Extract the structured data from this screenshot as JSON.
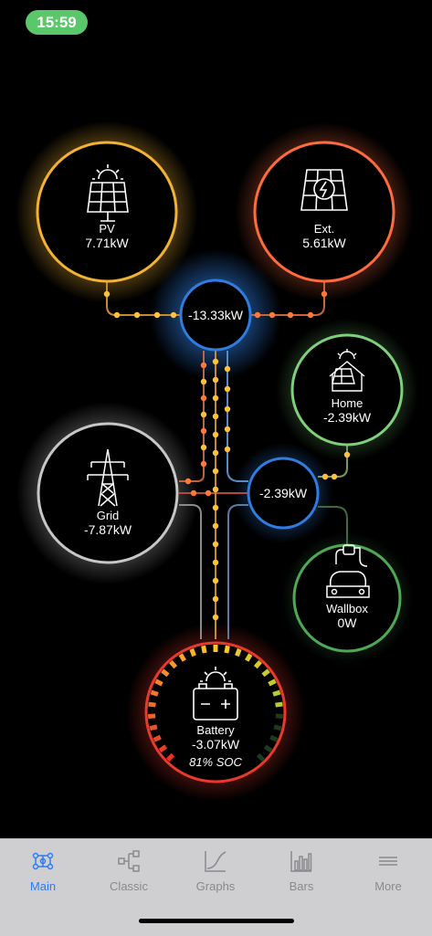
{
  "status_bar": {
    "time": "15:59"
  },
  "nodes": {
    "pv": {
      "label": "PV",
      "value": "7.71kW",
      "icon": "solar-panel-icon",
      "color": "#f2b233"
    },
    "ext": {
      "label": "Ext.",
      "value": "5.61kW",
      "icon": "external-solar-icon",
      "color": "#ff6b3d"
    },
    "hub_top": {
      "value": "-13.33kW",
      "color": "#2f7de0"
    },
    "home": {
      "label": "Home",
      "value": "-2.39kW",
      "icon": "house-solar-icon",
      "color": "#7ed07a"
    },
    "grid": {
      "label": "Grid",
      "value": "-7.87kW",
      "icon": "power-tower-icon",
      "color": "#b8b8b8"
    },
    "hub_mid": {
      "value": "-2.39kW",
      "color": "#2f7de0"
    },
    "wallbox": {
      "label": "Wallbox",
      "value": "0W",
      "icon": "car-charger-icon",
      "color": "#4ea856"
    },
    "battery": {
      "label": "Battery",
      "value": "-3.07kW",
      "soc_text": "81% SOC",
      "soc_fraction": 0.81,
      "icon": "battery-icon",
      "color": "#e83a2c"
    }
  },
  "tabs": [
    {
      "id": "main",
      "label": "Main",
      "icon": "main-flow-icon",
      "active": true
    },
    {
      "id": "classic",
      "label": "Classic",
      "icon": "classic-tree-icon",
      "active": false
    },
    {
      "id": "graphs",
      "label": "Graphs",
      "icon": "graph-curve-icon",
      "active": false
    },
    {
      "id": "bars",
      "label": "Bars",
      "icon": "bar-chart-icon",
      "active": false
    },
    {
      "id": "more",
      "label": "More",
      "icon": "menu-lines-icon",
      "active": false
    }
  ],
  "colors": {
    "accent": "#2c7cf6",
    "flow_dot": "#ffc23a",
    "flow_dot_alt": "#ff7a3a",
    "background": "#000000",
    "tabbar": "#cfcfd2"
  }
}
